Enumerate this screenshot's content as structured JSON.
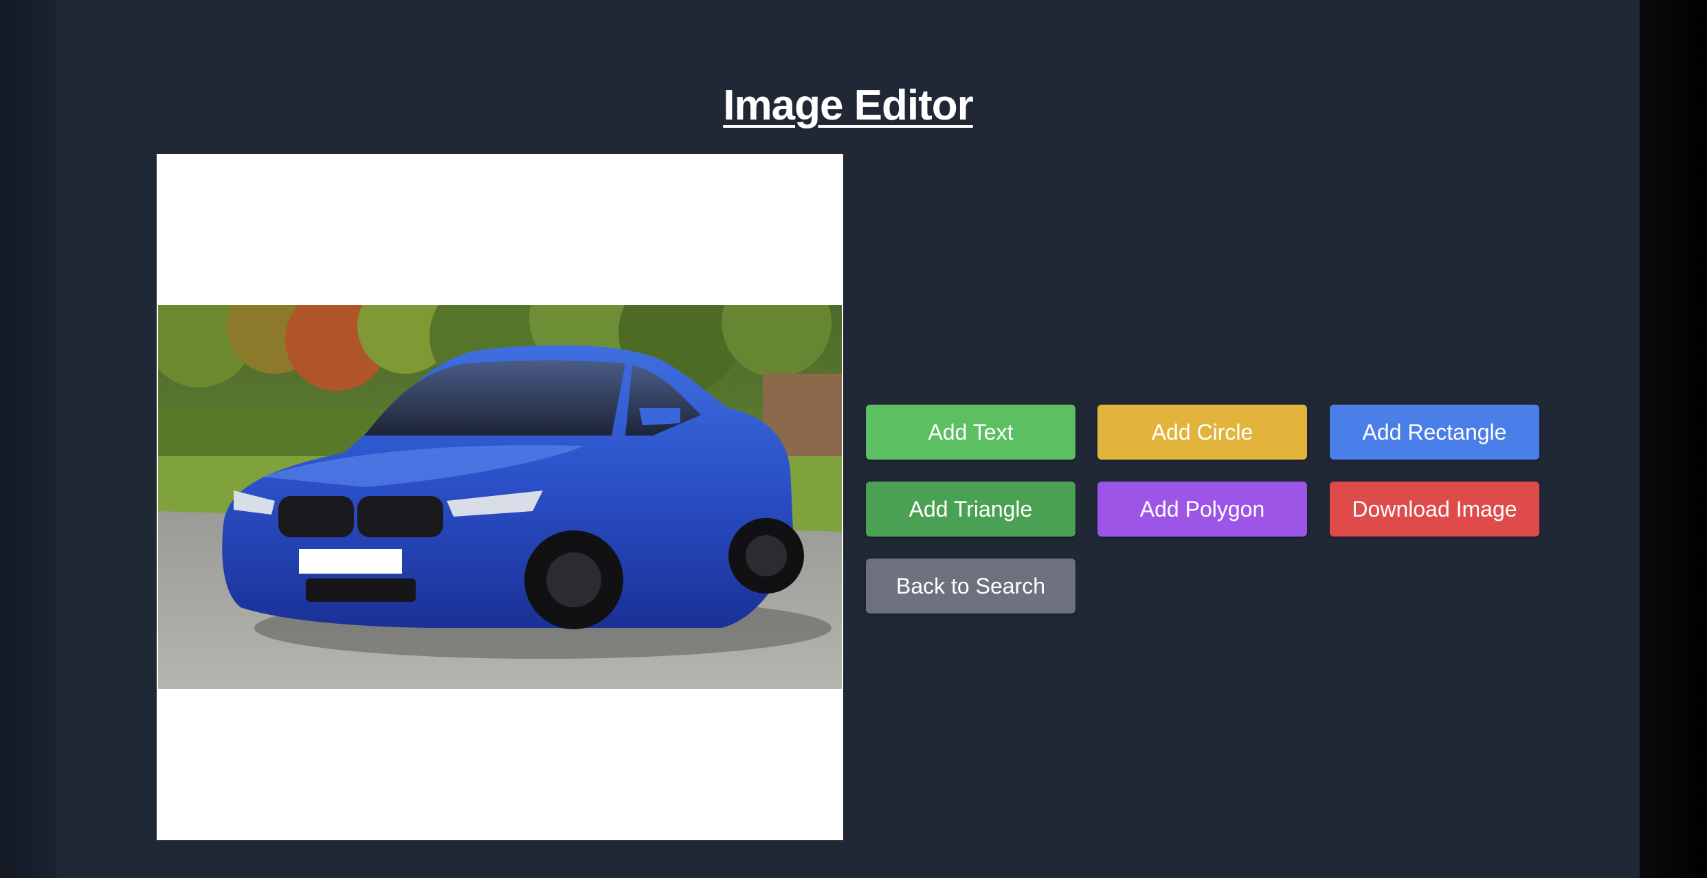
{
  "page": {
    "title": "Image Editor"
  },
  "toolbar": {
    "add_text": "Add Text",
    "add_circle": "Add Circle",
    "add_rectangle": "Add Rectangle",
    "add_triangle": "Add Triangle",
    "add_polygon": "Add Polygon",
    "download_image": "Download Image",
    "back_to_search": "Back to Search"
  },
  "colors": {
    "background": "#202735",
    "add_text": "#5cbf62",
    "add_circle": "#e2b43c",
    "add_rectangle": "#4a7ee8",
    "add_triangle": "#4ba153",
    "add_polygon": "#9d55e8",
    "download_image": "#df4a4a",
    "back_to_search": "#6c717d"
  },
  "canvas": {
    "image_subject": "blue car photo"
  }
}
